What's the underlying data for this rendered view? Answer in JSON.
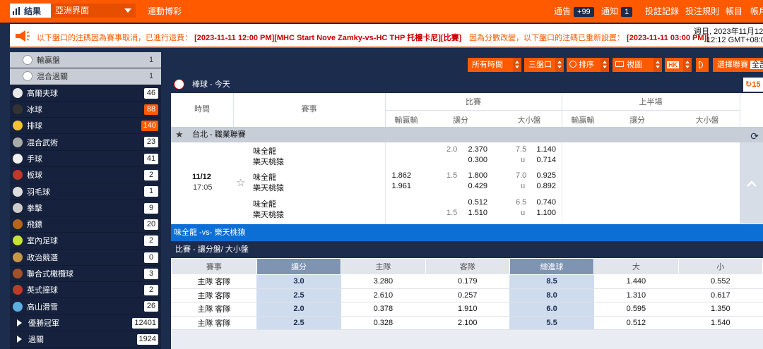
{
  "topbar": {
    "logo_label": "结果",
    "view_select": "亞洲界面",
    "sports_game": "運動博彩",
    "notice": "通告",
    "notice_count": "+99",
    "alerts": "通知",
    "alerts_count": "1",
    "bet_records": "投註記錄",
    "bet_rules": "投注規則",
    "account_a": "帳目",
    "account_b": "帳戶"
  },
  "ticker": {
    "msg1_prefix": "以下盤口的注碼因為賽事取消，已進行退費：",
    "msg1_detail": "[2023-11-11 12:00 PM][MHC Start Nove Zamky-vs-HC THP 托樓卡尼][比賽]",
    "msg2_prefix": "因為分數改變，以下盤口的注碼已重新設置：",
    "msg2_detail": "[2023-11-11 03:00 PM][",
    "date_line": "週日, 2023年11月12日",
    "time_line": "12:12 GMT+08:0"
  },
  "sidebar": {
    "items": [
      {
        "label": "輸贏盤",
        "count": "1",
        "sub": true
      },
      {
        "label": "混合過關",
        "count": "1",
        "sub": true
      },
      {
        "label": "高爾夫球",
        "count": "46",
        "color": "#e8e8e8"
      },
      {
        "label": "冰球",
        "count": "88",
        "hot": true,
        "color": "#333"
      },
      {
        "label": "排球",
        "count": "140",
        "hot": true,
        "color": "#f2c230"
      },
      {
        "label": "混合武術",
        "count": "23",
        "color": "#aaa"
      },
      {
        "label": "手球",
        "count": "41",
        "color": "#f0f0f0"
      },
      {
        "label": "板球",
        "count": "2",
        "color": "#c0392b"
      },
      {
        "label": "羽毛球",
        "count": "1",
        "color": "#ddd"
      },
      {
        "label": "拳擊",
        "count": "9",
        "color": "#ccc"
      },
      {
        "label": "飛鏢",
        "count": "20",
        "color": "#b5651d"
      },
      {
        "label": "室內足球",
        "count": "2",
        "color": "#c8e03a"
      },
      {
        "label": "政治競選",
        "count": "0",
        "color": "#c4954a"
      },
      {
        "label": "聯合式橄欖球",
        "count": "3",
        "color": "#a0522d"
      },
      {
        "label": "英式撞球",
        "count": "2",
        "color": "#c0392b"
      },
      {
        "label": "高山滑雪",
        "count": "26",
        "color": "#5dade2"
      },
      {
        "label": "優勝冠軍",
        "count": "12401",
        "tri": true
      },
      {
        "label": "過關",
        "count": "1924",
        "tri": true
      }
    ]
  },
  "filters": {
    "all_time": "所有時間",
    "three_markets": "三盤口",
    "sort": "排序",
    "view": "視圖",
    "odds_format": "HK",
    "choose_league": "選擇聯賽",
    "all": "全部"
  },
  "main": {
    "sport_title": "棒球 - 今天",
    "refresh_count": "15",
    "col_time": "時間",
    "col_event": "賽事",
    "col_full": "比賽",
    "col_half": "上半場",
    "sub_moneyline": "輸贏輸",
    "sub_handicap": "讓分",
    "sub_ou": "大小盤",
    "league_name": "台北 - 職業聯賽",
    "match": {
      "date": "11/12",
      "time": "17:05",
      "rows": [
        {
          "home": "味全龍",
          "away": "樂天桃猿",
          "hdp_line": "2.0",
          "hdp_home": "2.370",
          "hdp_away": "0.300",
          "ou_line": "7.5",
          "ou_over": "1.140",
          "ou_under": "0.714",
          "ml_home": "",
          "ml_away": "",
          "hdp_line_pos": "top"
        },
        {
          "home": "味全龍",
          "away": "樂天桃猿",
          "hdp_line": "1.5",
          "hdp_home": "1.800",
          "hdp_away": "0.429",
          "ou_line": "7.0",
          "ou_over": "0.925",
          "ou_under": "0.892",
          "ml_home": "1.862",
          "ml_away": "1.961",
          "hdp_line_pos": "top"
        },
        {
          "home": "味全龍",
          "away": "樂天桃猿",
          "hdp_line": "1.5",
          "hdp_home": "0.512",
          "hdp_away": "1.510",
          "ou_line": "6.5",
          "ou_over": "0.740",
          "ou_under": "1.100",
          "ml_home": "",
          "ml_away": "",
          "hdp_line_pos": "bottom"
        }
      ],
      "under_marker": "u"
    },
    "match_title": "味全龍 -vs- 樂天桃猿",
    "market_title": "比賽 - 讓分盤/ 大小盤",
    "detail_headers": [
      "賽事",
      "讓分",
      "主隊",
      "客隊",
      "總進球",
      "大",
      "小"
    ],
    "detail_rows": [
      [
        "主隊 客隊",
        "3.0",
        "3.280",
        "0.179",
        "8.5",
        "1.440",
        "0.552"
      ],
      [
        "主隊 客隊",
        "2.5",
        "2.610",
        "0.257",
        "8.0",
        "1.310",
        "0.617"
      ],
      [
        "主隊 客隊",
        "2.0",
        "0.378",
        "1.910",
        "6.0",
        "0.595",
        "1.350"
      ],
      [
        "主隊 客隊",
        "2.5",
        "0.328",
        "2.100",
        "5.5",
        "0.512",
        "1.540"
      ]
    ]
  }
}
